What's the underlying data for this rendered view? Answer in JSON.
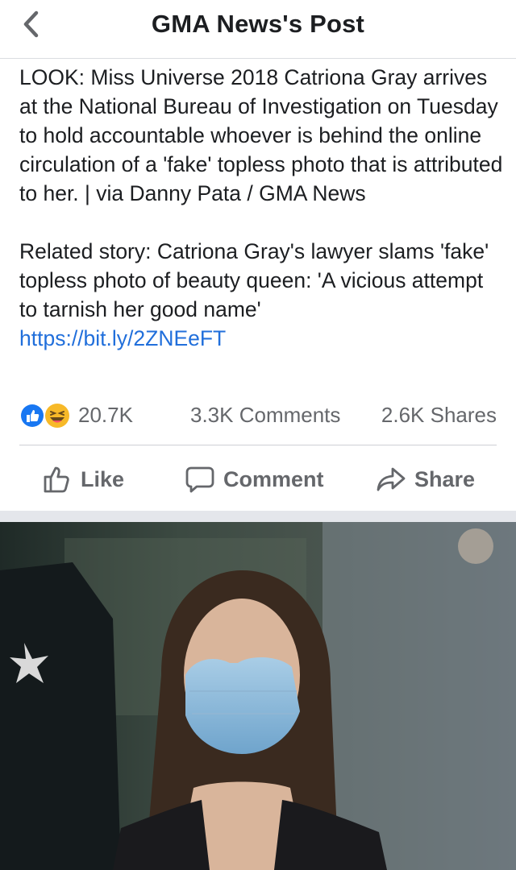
{
  "header": {
    "title": "GMA News's Post"
  },
  "post": {
    "paragraph1": "LOOK: Miss Universe 2018 Catriona Gray arrives at the National Bureau of Investigation on Tuesday to hold accountable whoever is behind the online circulation of a 'fake' topless photo that is attributed to her. | via Danny Pata / GMA News",
    "paragraph2": "Related story: Catriona Gray's lawyer slams 'fake' topless photo of beauty queen: 'A vicious attempt to tarnish her good name'",
    "link": "https://bit.ly/2ZNEeFT"
  },
  "stats": {
    "reactions": "20.7K",
    "comments": "3.3K Comments",
    "shares": "2.6K Shares"
  },
  "actions": {
    "like": "Like",
    "comment": "Comment",
    "share": "Share"
  },
  "colors": {
    "link": "#216fdb",
    "like_blue": "#1877f2",
    "haha_yellow": "#f7b928",
    "muted_text": "#65676b"
  },
  "icons": [
    "back-chevron-icon",
    "like-reaction-icon",
    "haha-reaction-icon",
    "thumbs-up-icon",
    "comment-bubble-icon",
    "share-arrow-icon"
  ]
}
